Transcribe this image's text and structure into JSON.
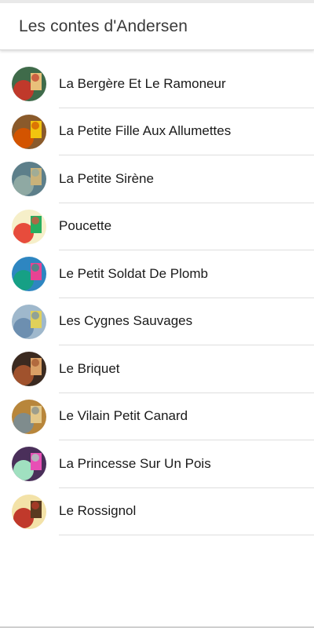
{
  "app_bar": {
    "title": "Les contes d'Andersen"
  },
  "stories": [
    {
      "label": "La Bergère Et Le Ramoneur",
      "icon": "cover-bergere-icon",
      "colors": [
        "#3f6b4a",
        "#c0392b",
        "#e8c07a"
      ]
    },
    {
      "label": "La Petite Fille Aux Allumettes",
      "icon": "cover-allumettes-icon",
      "colors": [
        "#8a5a2b",
        "#d35400",
        "#f1c40f"
      ]
    },
    {
      "label": "La Petite Sirène",
      "icon": "cover-sirene-icon",
      "colors": [
        "#5d7f8a",
        "#8fa9a3",
        "#c9b27a"
      ]
    },
    {
      "label": "Poucette",
      "icon": "cover-poucette-icon",
      "colors": [
        "#f6efc9",
        "#e74c3c",
        "#27ae60"
      ]
    },
    {
      "label": "Le Petit Soldat De Plomb",
      "icon": "cover-soldat-icon",
      "colors": [
        "#2e86c1",
        "#16a085",
        "#e84393"
      ]
    },
    {
      "label": "Les Cygnes Sauvages",
      "icon": "cover-cygnes-icon",
      "colors": [
        "#9fb8cc",
        "#6d8fb0",
        "#e0d05a"
      ]
    },
    {
      "label": "Le Briquet",
      "icon": "cover-briquet-icon",
      "colors": [
        "#3b2a20",
        "#a0522d",
        "#d9a066"
      ]
    },
    {
      "label": "Le Vilain Petit Canard",
      "icon": "cover-canard-icon",
      "colors": [
        "#b8863b",
        "#7f8c8d",
        "#e3c88a"
      ]
    },
    {
      "label": "La Princesse Sur Un Pois",
      "icon": "cover-princesse-icon",
      "colors": [
        "#4a2f5a",
        "#a0e0c0",
        "#e84fb5"
      ]
    },
    {
      "label": "Le Rossignol",
      "icon": "cover-rossignol-icon",
      "colors": [
        "#f3e2a8",
        "#c0392b",
        "#5a3a20"
      ]
    }
  ]
}
